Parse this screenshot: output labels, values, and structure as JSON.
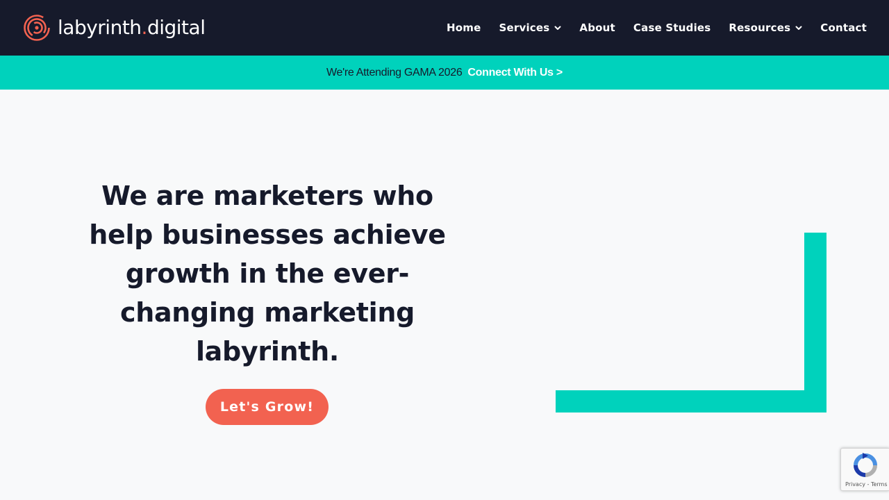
{
  "brand": {
    "name_part1": "labyrinth",
    "name_dot": ".",
    "name_part2": "digital",
    "logo_icon": "labyrinth-spiral-icon",
    "accent_color": "#f26250"
  },
  "nav": {
    "items": [
      {
        "label": "Home",
        "has_dropdown": false
      },
      {
        "label": "Services",
        "has_dropdown": true
      },
      {
        "label": "About",
        "has_dropdown": false
      },
      {
        "label": "Case Studies",
        "has_dropdown": false
      },
      {
        "label": "Resources",
        "has_dropdown": true
      },
      {
        "label": "Contact",
        "has_dropdown": false
      }
    ],
    "background_color": "#161a2b"
  },
  "banner": {
    "text": "We're Attending GAMA 2026",
    "link_label": "Connect With Us >",
    "background_color": "#00d2bc"
  },
  "hero": {
    "heading": "We are marketers who help  businesses achieve growth in the ever-changing marketing labyrinth.",
    "cta_label": "Let's Grow!",
    "cta_color": "#f26250",
    "decoration_color": "#00d2bc"
  },
  "recaptcha": {
    "icon": "recaptcha-icon",
    "privacy_label": "Privacy",
    "separator": " - ",
    "terms_label": "Terms"
  }
}
